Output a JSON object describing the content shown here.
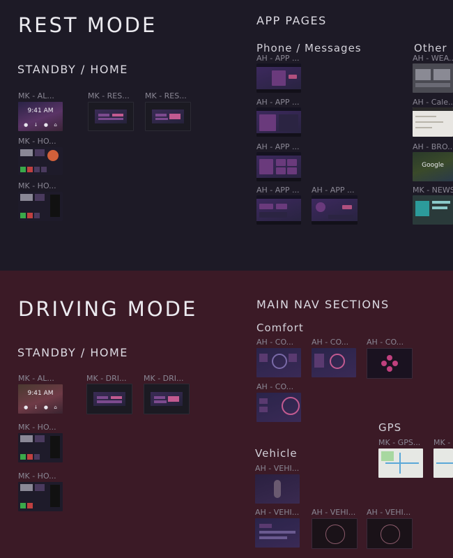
{
  "rest": {
    "title": "REST MODE",
    "standby_heading": "STANDBY / HOME",
    "standby_frames": [
      "MK - AL...",
      "MK - RES...",
      "MK - RES...",
      "MK - HO...",
      "MK - HO..."
    ],
    "lock_time": "9:41 AM",
    "app_pages_heading": "APP PAGES",
    "phone_heading": "Phone / Messages",
    "phone_frames": [
      "AH - APP ...",
      "AH - APP ...",
      "AH - APP ...",
      "AH - APP ...",
      "AH - APP ..."
    ],
    "other_heading": "Other",
    "other_frames": [
      "AH - WEA...",
      "AH - Cale...",
      "AH - BRO...",
      "MK - NEWS..."
    ],
    "google_text": "Google"
  },
  "driving": {
    "title": "DRIVING MODE",
    "standby_heading": "STANDBY / HOME",
    "standby_frames": [
      "MK - AL...",
      "MK - DRI...",
      "MK - DRI...",
      "MK - HO...",
      "MK - HO..."
    ],
    "lock_time": "9:41 AM",
    "main_nav_heading": "MAIN NAV SECTIONS",
    "comfort_heading": "Comfort",
    "comfort_frames": [
      "AH - CO...",
      "AH - CO...",
      "AH - CO...",
      "AH - CO..."
    ],
    "gps_heading": "GPS",
    "gps_frames": [
      "MK - GPS...",
      "MK - "
    ],
    "vehicle_heading": "Vehicle",
    "vehicle_frames": [
      "AH - VEHI...",
      "AH - VEHI...",
      "AH - VEHI...",
      "AH - VEHI..."
    ]
  },
  "lock_icons": [
    "pin-icon",
    "download-icon",
    "dot-icon",
    "home-icon"
  ],
  "colors": {
    "rest_bg": "#1d1a26",
    "driving_bg": "#3b1a26",
    "accent": "#c25a90"
  }
}
